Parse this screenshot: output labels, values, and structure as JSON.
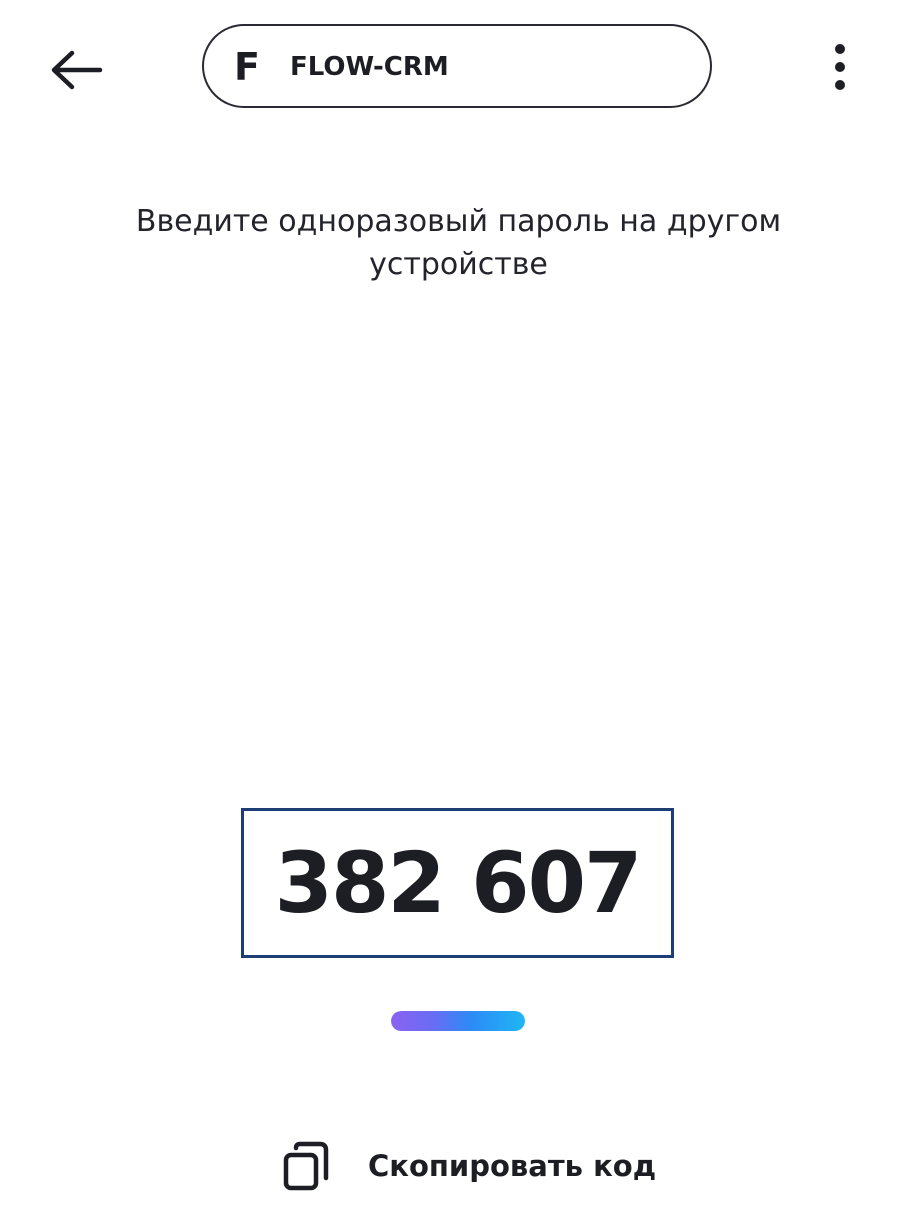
{
  "header": {
    "back_icon": "arrow-left-icon",
    "account": {
      "letter": "F",
      "name": "FLOW-CRM"
    },
    "menu_icon": "more-vertical-icon"
  },
  "main": {
    "instruction": "Введите одноразовый пароль на другом устройстве",
    "code": "382 607",
    "timer_remaining_fraction": 1.0
  },
  "actions": {
    "copy_icon": "copy-icon",
    "copy_label": "Скопировать код"
  },
  "colors": {
    "text": "#1d1d24",
    "code_border": "#1d3e74",
    "timer_start": "#8b62f2",
    "timer_end": "#1fb6f5"
  }
}
